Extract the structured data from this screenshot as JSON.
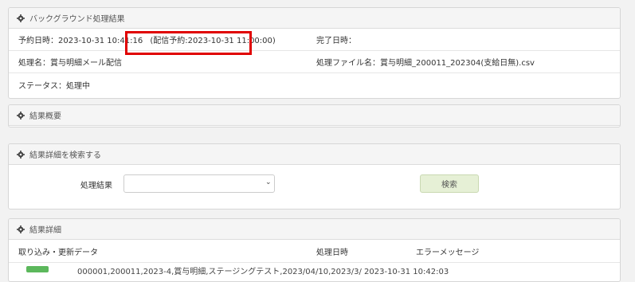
{
  "bg_panel": {
    "title": "バックグラウンド処理結果",
    "schedule_label": "予約日時：",
    "schedule_value": "2023-10-31 10:41:16",
    "delivery_note": "(配信予約:2023-10-31 11:00:00)",
    "complete_label": "完了日時：",
    "complete_value": "",
    "process_name_label": "処理名：",
    "process_name_value": "賞与明細メール配信",
    "file_label": "処理ファイル名：",
    "file_value": "賞与明細_200011_202304(支給日無).csv",
    "status_label": "ステータス：",
    "status_value": "処理中"
  },
  "summary_panel": {
    "title": "結果概要"
  },
  "search_panel": {
    "title": "結果詳細を検索する",
    "result_label": "処理結果",
    "result_selected": "",
    "search_button": "検索"
  },
  "detail_panel": {
    "title": "結果詳細",
    "columns": [
      "取り込み・更新データ",
      "処理日時",
      "エラーメッセージ"
    ],
    "first_row_text": "000001,200011,2023-4,賞与明細,ステージングテスト,2023/04/10,2023/3/ 2023-10-31 10:42:03"
  },
  "colors": {
    "highlight": "#e00000",
    "badge": "#5cb85c"
  },
  "icons": {
    "panel_header": "gear-icon",
    "select_arrow": "chevron-down-icon"
  }
}
